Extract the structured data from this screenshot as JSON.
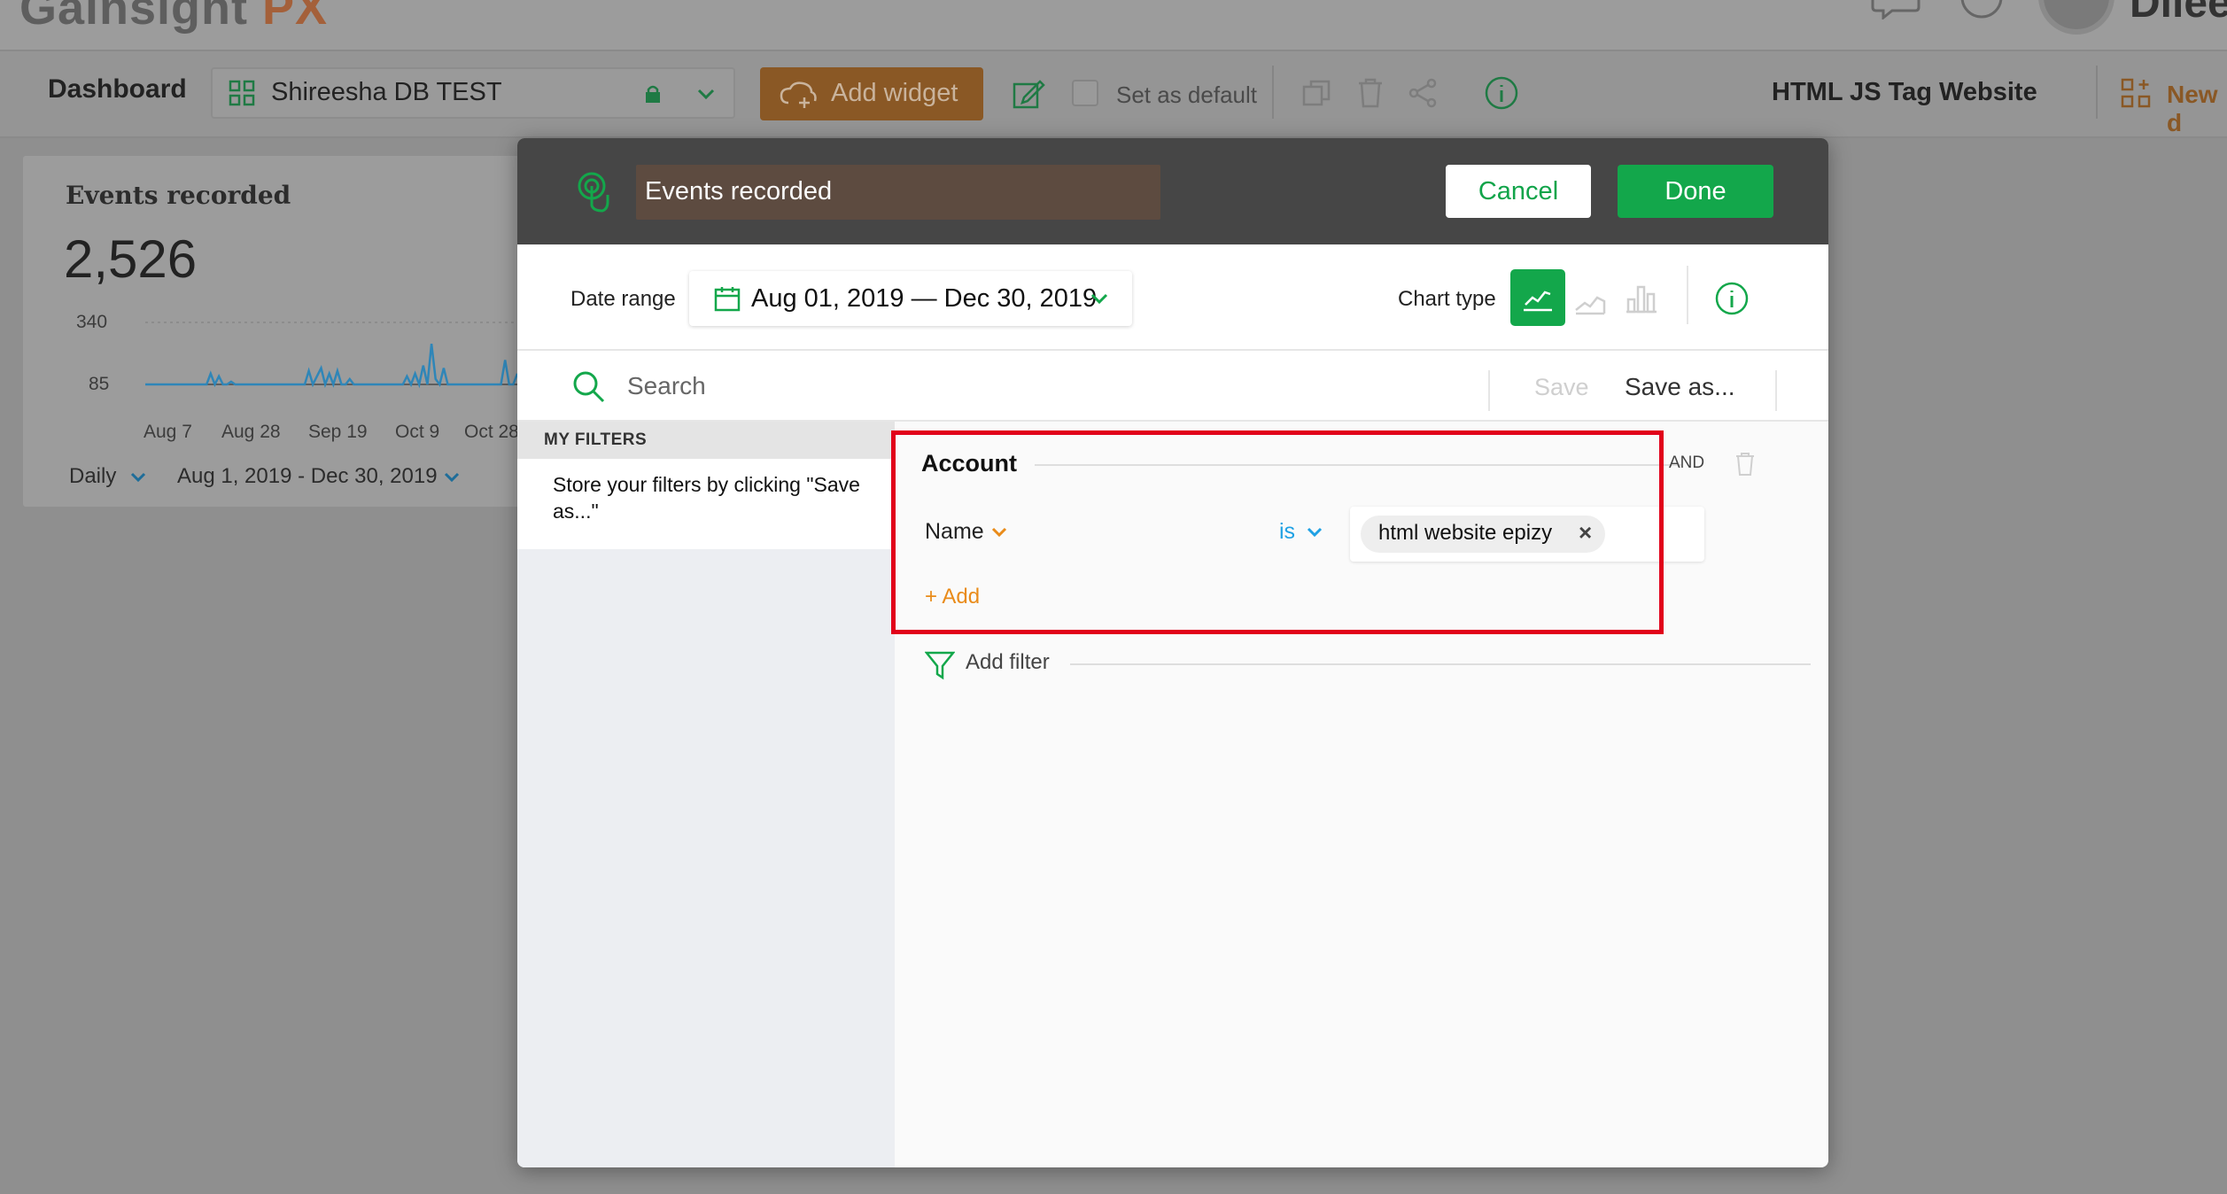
{
  "app": {
    "brand_main": "Gainsight",
    "brand_accent": "PX",
    "user_name": "Dileep"
  },
  "toolbar": {
    "title": "Dashboard",
    "selected_dashboard": "Shireesha DB TEST",
    "add_widget_label": "Add widget",
    "set_default_label": "Set as default",
    "site_title": "HTML JS Tag Website",
    "new_label": "New d"
  },
  "widget": {
    "title": "Events recorded",
    "value": "2,526",
    "interval_label": "Daily",
    "range_label": "Aug 1, 2019 - Dec 30, 2019",
    "chart_data": {
      "type": "line",
      "title": "Events recorded",
      "y_ticks": [
        "340",
        "85"
      ],
      "x_ticks": [
        "Aug 7",
        "Aug 28",
        "Sep 19",
        "Oct 9",
        "Oct 28"
      ],
      "values": [
        0,
        0,
        0,
        0,
        0,
        0,
        0,
        0,
        0,
        0,
        0,
        0,
        0,
        0,
        0,
        0,
        40,
        0,
        30,
        0,
        0,
        10,
        0,
        0,
        0,
        0,
        0,
        0,
        0,
        0,
        0,
        0,
        0,
        0,
        0,
        0,
        0,
        0,
        0,
        0,
        50,
        0,
        30,
        60,
        0,
        40,
        0,
        50,
        0,
        0,
        20,
        0,
        0,
        0,
        0,
        0,
        0,
        0,
        0,
        0,
        0,
        0,
        0,
        0,
        30,
        0,
        40,
        0,
        70,
        0,
        150,
        20,
        0,
        60,
        0,
        0,
        0,
        0,
        0,
        0,
        0,
        0,
        0,
        0,
        0,
        0,
        0,
        0,
        90,
        0,
        0,
        40
      ],
      "ylim": [
        0,
        340
      ],
      "color": "#2f86b8"
    }
  },
  "modal": {
    "title": "Events recorded",
    "cancel_label": "Cancel",
    "done_label": "Done",
    "date_range_label": "Date range",
    "date_range_value": "Aug 01, 2019 — Dec 30, 2019",
    "chart_type_label": "Chart type",
    "search_placeholder": "Search",
    "save_label": "Save",
    "save_as_label": "Save as...",
    "my_filters_title": "MY FILTERS",
    "filters_hint": "Store your filters by clicking \"Save as...\"",
    "filter_group": {
      "title": "Account",
      "join_label": "AND",
      "condition": {
        "field": "Name",
        "operator": "is",
        "value": "html website epizy"
      },
      "add_label": "+ Add"
    },
    "add_filter_label": "Add filter"
  },
  "colors": {
    "green": "#13a74b",
    "orange": "#e98b19",
    "blue": "#1fa1e4",
    "highlight_red": "#e1001a"
  }
}
